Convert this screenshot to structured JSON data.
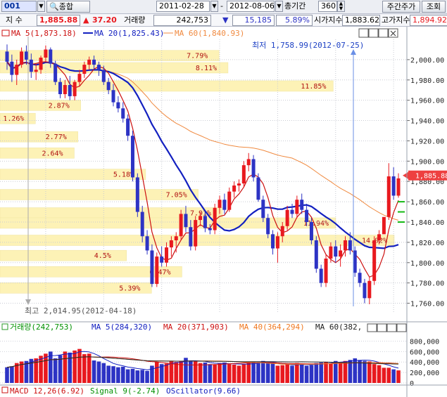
{
  "toolbar": {
    "code": "001",
    "search_tab": "종합",
    "start_date": "2011-02-28",
    "end_date": "2012-08-06",
    "period_label": "총기간",
    "period_value": "360",
    "weekly_button": "주간주가",
    "query_button": "조회"
  },
  "quote": {
    "index_label": "지 수",
    "index_value": "1,885.88",
    "change_arrow": "▲",
    "change_value": "37.20",
    "volume_label": "거래량",
    "volume_value": "242,753",
    "vol_change_arrow": "▼",
    "vol_change_value": "15,185",
    "pct_value": "5.89%",
    "open_label": "시가지수",
    "open_value": "1,883.62",
    "high_label": "고가지수",
    "high_value": "1,894.92"
  },
  "price_legend": {
    "ma5": "MA 5(1,873.18)",
    "ma20": "MA 20(1,825.43)",
    "ma60": "MA 60(1,840.93)"
  },
  "volume_legend": {
    "title": "거래량(242,753)",
    "ma5": "MA 5(284,320)",
    "ma20": "MA 20(371,903)",
    "ma40": "MA 40(364,294)",
    "ma60": "MA 60(382,"
  },
  "macd_legend": {
    "macd": "MACD 12,26(6.92)",
    "signal": "Signal 9(-2.74)",
    "osc": "OScillator(9.66)"
  },
  "annotations": {
    "low": "최저 1,758.99(2012-07-25)",
    "high": "최고 2,014.95(2012-04-18)"
  },
  "colors": {
    "up": "#e8191f",
    "down": "#2d33c4",
    "ma5": "#cc1010",
    "ma20": "#1320c0",
    "ma60": "#f08a40",
    "profile": "#fdf2b6",
    "current": "#ee4040"
  },
  "chart_data": {
    "type": "candlestick",
    "price_axis": {
      "ticks": [
        "2,000.00",
        "1,980.00",
        "1,960.00",
        "1,940.00",
        "1,920.00",
        "1,900.00",
        "1,880.00",
        "1,860.00",
        "1,840.00",
        "1,820.00",
        "1,800.00",
        "1,780.00",
        "1,760.00"
      ],
      "range": [
        1750,
        2020
      ]
    },
    "current_price": "1,885.88",
    "price_profile": [
      {
        "price": 2004,
        "pct": "7.79%"
      },
      {
        "price": 1992,
        "pct": "8.11%"
      },
      {
        "price": 1974,
        "pct": "11.85%"
      },
      {
        "price": 1955,
        "pct": "2.87%"
      },
      {
        "price": 1942,
        "pct": "1.26%"
      },
      {
        "price": 1924,
        "pct": "2.77%"
      },
      {
        "price": 1908,
        "pct": "2.64%"
      },
      {
        "price": 1887,
        "pct": "5.18%"
      },
      {
        "price": 1867,
        "pct": "7.05%"
      },
      {
        "price": 1849,
        "pct": "7.91%"
      },
      {
        "price": 1839,
        "pct": "11.94%"
      },
      {
        "price": 1822,
        "pct": "14.02%"
      },
      {
        "price": 1807,
        "pct": "4.5%"
      },
      {
        "price": 1791,
        "pct": "6.47%"
      },
      {
        "price": 1775,
        "pct": "5.39%"
      }
    ],
    "candles": [
      [
        2008,
        2015,
        1990,
        1998
      ],
      [
        1998,
        2005,
        1978,
        1985
      ],
      [
        1985,
        2000,
        1975,
        1995
      ],
      [
        1995,
        2012,
        1992,
        2008
      ],
      [
        2008,
        2014,
        1995,
        2000
      ],
      [
        2000,
        2006,
        1982,
        1988
      ],
      [
        1988,
        1996,
        1980,
        1990
      ],
      [
        1990,
        2004,
        1986,
        2002
      ],
      [
        2002,
        2014,
        1998,
        2010
      ],
      [
        2010,
        2012,
        1992,
        1996
      ],
      [
        1996,
        1999,
        1975,
        1978
      ],
      [
        1978,
        1982,
        1962,
        1966
      ],
      [
        1966,
        1980,
        1962,
        1975
      ],
      [
        1975,
        1984,
        1960,
        1964
      ],
      [
        1964,
        1980,
        1960,
        1978
      ],
      [
        1978,
        1990,
        1974,
        1986
      ],
      [
        1986,
        1998,
        1982,
        1995
      ],
      [
        1995,
        2003,
        1990,
        2000
      ],
      [
        2000,
        2004,
        1990,
        1995
      ],
      [
        1995,
        1998,
        1984,
        1990
      ],
      [
        1990,
        1994,
        1975,
        1978
      ],
      [
        1978,
        1982,
        1966,
        1970
      ],
      [
        1970,
        1976,
        1954,
        1958
      ],
      [
        1958,
        1964,
        1948,
        1952
      ],
      [
        1952,
        1958,
        1938,
        1942
      ],
      [
        1942,
        1946,
        1920,
        1925
      ],
      [
        1925,
        1930,
        1880,
        1884
      ],
      [
        1884,
        1888,
        1845,
        1850
      ],
      [
        1850,
        1856,
        1820,
        1826
      ],
      [
        1826,
        1832,
        1808,
        1812
      ],
      [
        1812,
        1818,
        1776,
        1779
      ],
      [
        1779,
        1810,
        1776,
        1806
      ],
      [
        1806,
        1816,
        1796,
        1800
      ],
      [
        1800,
        1820,
        1796,
        1815
      ],
      [
        1815,
        1826,
        1806,
        1822
      ],
      [
        1822,
        1830,
        1810,
        1826
      ],
      [
        1826,
        1852,
        1822,
        1848
      ],
      [
        1848,
        1856,
        1830,
        1835
      ],
      [
        1835,
        1842,
        1812,
        1816
      ],
      [
        1816,
        1846,
        1812,
        1842
      ],
      [
        1842,
        1850,
        1836,
        1846
      ],
      [
        1846,
        1850,
        1830,
        1834
      ],
      [
        1834,
        1838,
        1828,
        1832
      ],
      [
        1832,
        1858,
        1828,
        1854
      ],
      [
        1854,
        1866,
        1848,
        1862
      ],
      [
        1862,
        1868,
        1848,
        1852
      ],
      [
        1852,
        1874,
        1850,
        1870
      ],
      [
        1870,
        1880,
        1864,
        1876
      ],
      [
        1876,
        1882,
        1870,
        1878
      ],
      [
        1878,
        1900,
        1874,
        1896
      ],
      [
        1896,
        1908,
        1890,
        1902
      ],
      [
        1902,
        1906,
        1880,
        1884
      ],
      [
        1884,
        1888,
        1860,
        1862
      ],
      [
        1862,
        1866,
        1840,
        1844
      ],
      [
        1844,
        1848,
        1824,
        1828
      ],
      [
        1828,
        1832,
        1808,
        1814
      ],
      [
        1814,
        1830,
        1800,
        1826
      ],
      [
        1826,
        1840,
        1820,
        1836
      ],
      [
        1836,
        1856,
        1832,
        1852
      ],
      [
        1852,
        1858,
        1844,
        1848
      ],
      [
        1848,
        1866,
        1844,
        1862
      ],
      [
        1862,
        1868,
        1848,
        1852
      ],
      [
        1852,
        1858,
        1836,
        1840
      ],
      [
        1840,
        1844,
        1818,
        1822
      ],
      [
        1822,
        1826,
        1790,
        1794
      ],
      [
        1794,
        1798,
        1776,
        1780
      ],
      [
        1780,
        1808,
        1776,
        1804
      ],
      [
        1804,
        1820,
        1800,
        1816
      ],
      [
        1816,
        1822,
        1800,
        1806
      ],
      [
        1806,
        1818,
        1796,
        1812
      ],
      [
        1812,
        1826,
        1806,
        1822
      ],
      [
        1822,
        1830,
        1808,
        1812
      ],
      [
        1812,
        1816,
        1786,
        1790
      ],
      [
        1790,
        1794,
        1776,
        1780
      ],
      [
        1780,
        1784,
        1760,
        1765
      ],
      [
        1765,
        1786,
        1759,
        1782
      ],
      [
        1782,
        1826,
        1778,
        1822
      ],
      [
        1822,
        1832,
        1818,
        1828
      ],
      [
        1828,
        1834,
        1840,
        1845
      ],
      [
        1845,
        1898,
        1842,
        1885
      ],
      [
        1885,
        1894,
        1862,
        1866
      ],
      [
        1866,
        1888,
        1864,
        1883
      ]
    ],
    "volume_axis": {
      "ticks": [
        "800,000",
        "600,000",
        "400,000",
        "200,000",
        "0"
      ],
      "range": [
        0,
        900000
      ]
    },
    "volumes": [
      300000,
      320000,
      380000,
      410000,
      420000,
      460000,
      470000,
      520000,
      560000,
      600000,
      470000,
      530000,
      600000,
      580000,
      620000,
      650000,
      550000,
      560000,
      430000,
      410000,
      380000,
      330000,
      320000,
      300000,
      310000,
      260000,
      270000,
      240000,
      250000,
      230000,
      330000,
      400000,
      360000,
      370000,
      410000,
      400000,
      420000,
      480000,
      410000,
      410000,
      380000,
      390000,
      360000,
      350000,
      380000,
      390000,
      360000,
      350000,
      330000,
      360000,
      390000,
      410000,
      400000,
      420000,
      380000,
      380000,
      330000,
      340000,
      360000,
      330000,
      380000,
      360000,
      330000,
      340000,
      380000,
      390000,
      400000,
      380000,
      420000,
      400000,
      420000,
      440000,
      470000,
      430000,
      420000,
      410000,
      360000,
      340000,
      290000,
      290000,
      260000,
      240000
    ]
  }
}
